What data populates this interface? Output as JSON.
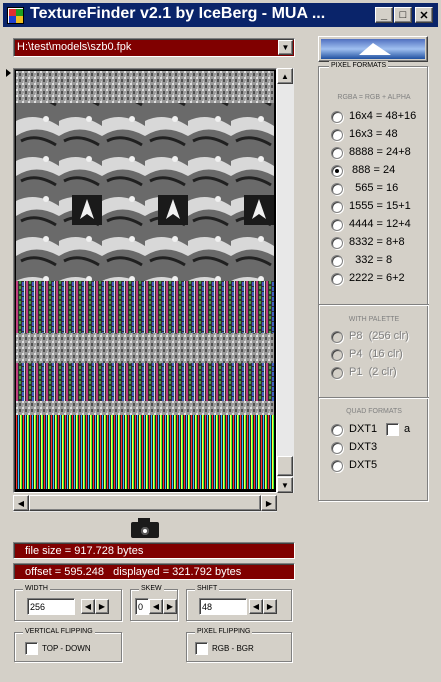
{
  "window": {
    "title": "TextureFinder v2.1 by IceBerg - MUA ...",
    "minimize_glyph": "_",
    "maximize_glyph": "□",
    "close_glyph": "✕"
  },
  "file": {
    "path": "H:\\test\\models\\szb0.fpk"
  },
  "info": {
    "file_size": "file size = 917.728 bytes",
    "offset_displayed": "offset = 595.248   displayed = 321.792 bytes"
  },
  "controls": {
    "width": {
      "label": "WIDTH",
      "value": "256"
    },
    "skew": {
      "label": "SKEW",
      "value": "0"
    },
    "shift": {
      "label": "SHIFT",
      "value": "48"
    },
    "vertical_flipping": {
      "label": "VERTICAL FLIPPING",
      "checkbox_label": "TOP - DOWN",
      "checked": false
    },
    "pixel_flipping": {
      "label": "PIXEL FLIPPING",
      "checkbox_label": "RGB  -  BGR",
      "checked": false
    }
  },
  "pixel_formats": {
    "title": "PIXEL FORMATS",
    "subtitle": "RGBA = RGB + ALPHA",
    "options": [
      {
        "label": "16x4 = 48+16",
        "checked": false
      },
      {
        "label": "16x3 = 48",
        "checked": false
      },
      {
        "label": "8888 = 24+8",
        "checked": false
      },
      {
        "label": " 888 = 24",
        "checked": true
      },
      {
        "label": "  565 = 16",
        "checked": false
      },
      {
        "label": "1555 = 15+1",
        "checked": false
      },
      {
        "label": "4444 = 12+4",
        "checked": false
      },
      {
        "label": "8332 = 8+8",
        "checked": false
      },
      {
        "label": "  332 = 8",
        "checked": false
      },
      {
        "label": "2222 = 6+2",
        "checked": false
      }
    ],
    "palette_title": "WITH PALETTE",
    "palette_options": [
      {
        "label": "P8  (256 clr)"
      },
      {
        "label": "P4  (16 clr)"
      },
      {
        "label": "P1  (2 clr)"
      }
    ],
    "quad_title": "QUAD FORMATS",
    "quad_options": [
      {
        "label": "DXT1"
      },
      {
        "label": "DXT3"
      },
      {
        "label": "DXT5"
      }
    ],
    "dxt1_alpha_label": "a"
  },
  "icons": {
    "scroll_up": "▲",
    "scroll_down": "▼",
    "scroll_left": "◀",
    "scroll_right": "▶",
    "dropdown": "▼"
  }
}
